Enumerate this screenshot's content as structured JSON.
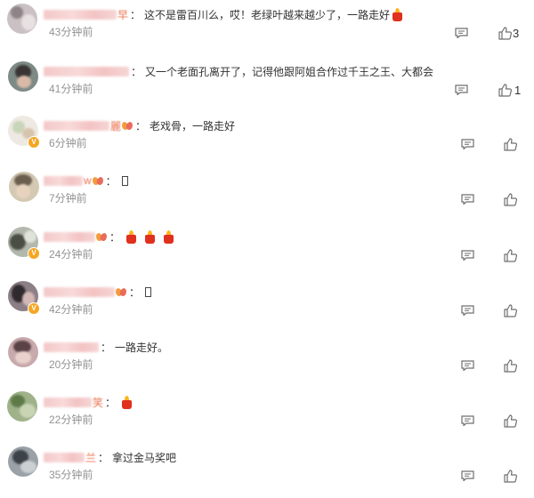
{
  "comments": [
    {
      "name_tail": "早",
      "text": "这不是雷百川么，哎！老绿叶越来越少了，一路走好",
      "time": "43分钟前",
      "likes": "3",
      "candles": 1,
      "fan": false,
      "vip": false
    },
    {
      "name_tail": "",
      "text": "又一个老面孔离开了，记得他跟阿姐合作过千王之王、大都会",
      "time": "41分钟前",
      "likes": "1",
      "candles": 0,
      "fan": false,
      "vip": false
    },
    {
      "name_tail": "麗",
      "text": "老戏骨，一路走好",
      "time": "6分钟前",
      "likes": "",
      "candles": 0,
      "fan": true,
      "vip": true
    },
    {
      "name_tail": "w",
      "text": "",
      "time": "7分钟前",
      "likes": "",
      "candles": 0,
      "fan": true,
      "vip": false,
      "box": true
    },
    {
      "name_tail": "",
      "text": "",
      "time": "24分钟前",
      "likes": "",
      "candles": 3,
      "fan": true,
      "vip": true
    },
    {
      "name_tail": "",
      "text": "",
      "time": "42分钟前",
      "likes": "",
      "candles": 0,
      "fan": true,
      "vip": true,
      "box": true
    },
    {
      "name_tail": "",
      "text": "一路走好。",
      "time": "20分钟前",
      "likes": "",
      "candles": 0,
      "fan": false,
      "vip": false
    },
    {
      "name_tail": "笑",
      "text": "",
      "time": "22分钟前",
      "likes": "",
      "candles": 1,
      "fan": false,
      "vip": false
    },
    {
      "name_tail": "兰",
      "text": "拿过金马奖吧",
      "time": "35分钟前",
      "likes": "",
      "candles": 0,
      "fan": false,
      "vip": false
    }
  ],
  "icons": {
    "reply": "comment-icon",
    "like": "thumbs-up-icon",
    "candle": "candle-emoji",
    "fan": "fan-badge-icon",
    "vip": "verified-badge-icon"
  },
  "colors": {
    "text": "#333333",
    "time": "#939393",
    "name": "#eb7350",
    "icon": "#6f6f6f",
    "badge": "#f5a623",
    "candle": "#e0301e"
  }
}
